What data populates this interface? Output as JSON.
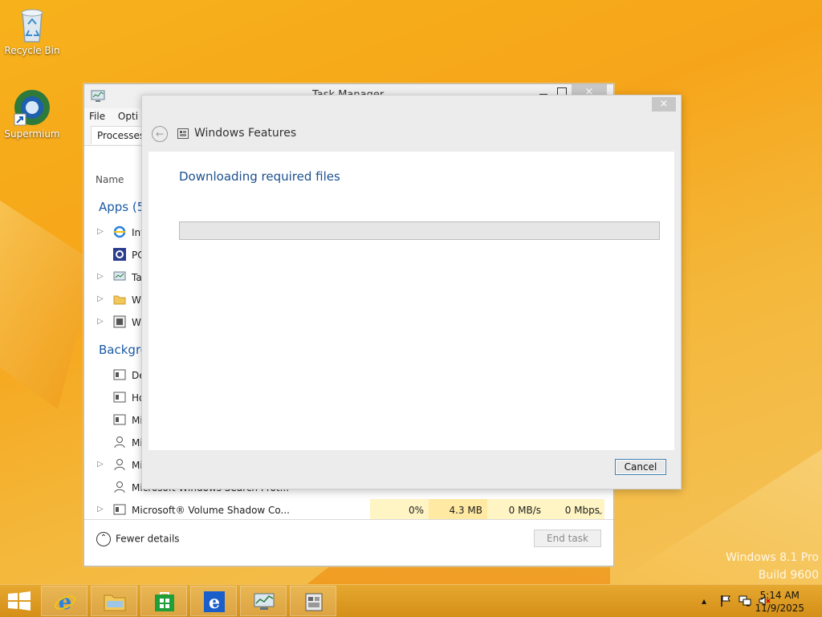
{
  "desktop": {
    "icons": [
      {
        "label": "Recycle Bin"
      },
      {
        "label": "Supermium"
      }
    ]
  },
  "task_manager": {
    "title": "Task Manager",
    "menu": [
      "File",
      "Opti"
    ],
    "tab": "Processes",
    "column_name": "Name",
    "groups": {
      "apps": "Apps (5",
      "background": "Backgro"
    },
    "rows": [
      {
        "name": "Int"
      },
      {
        "name": "PC"
      },
      {
        "name": "Ta"
      },
      {
        "name": "Wi"
      },
      {
        "name": "Wi"
      },
      {
        "name": "De"
      },
      {
        "name": "Ho"
      },
      {
        "name": "Mi"
      },
      {
        "name": "Mi"
      },
      {
        "name": "Mi"
      },
      {
        "name": "Microsoft Windows Search Prot..."
      },
      {
        "name": "Microsoft® Volume Shadow Co...",
        "cpu": "0%",
        "memory": "4.3 MB",
        "disk": "0 MB/s",
        "network": "0 Mbps"
      }
    ],
    "fewer_details": "Fewer details",
    "end_task": "End task"
  },
  "windows_features": {
    "title": "Windows Features",
    "message": "Downloading required files",
    "progress": 0,
    "cancel": "Cancel",
    "close": "×",
    "back_icon": "back-arrow-icon"
  },
  "watermark": {
    "line1": "Windows 8.1 Pro",
    "line2": "Build 9600"
  },
  "taskbar": {
    "clock_time": "5:14 AM",
    "clock_date": "11/9/2025",
    "pinned": [
      "internet-explorer",
      "file-explorer",
      "store",
      "internet-explorer-modern",
      "task-manager",
      "windows-features"
    ]
  },
  "colors": {
    "accent": "#1b4f8f",
    "desktop": "#f6a51a",
    "taskbar": "#d48f18"
  }
}
